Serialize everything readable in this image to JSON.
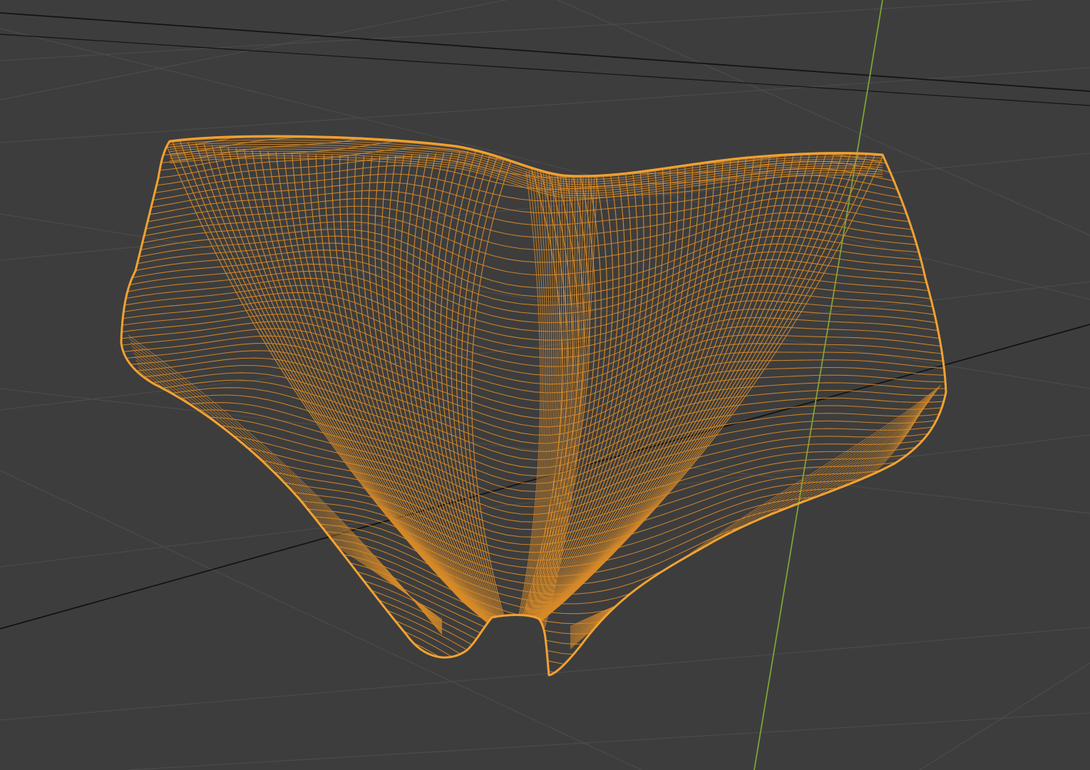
{
  "viewport": {
    "kind": "3d-viewport",
    "shading": "wireframe",
    "background_color": "#3d3d3d",
    "grid_color": "#4a4a4a",
    "horizon_line_color": "#141414",
    "x_axis_color": "#101010",
    "y_axis_color": "#7aa33a",
    "selection_outline_color": "#f2a232",
    "wire_color": "#d98b28"
  },
  "object": {
    "kind": "mesh",
    "shape": "briefs garment",
    "selected": true,
    "icon": "mesh-icon"
  }
}
